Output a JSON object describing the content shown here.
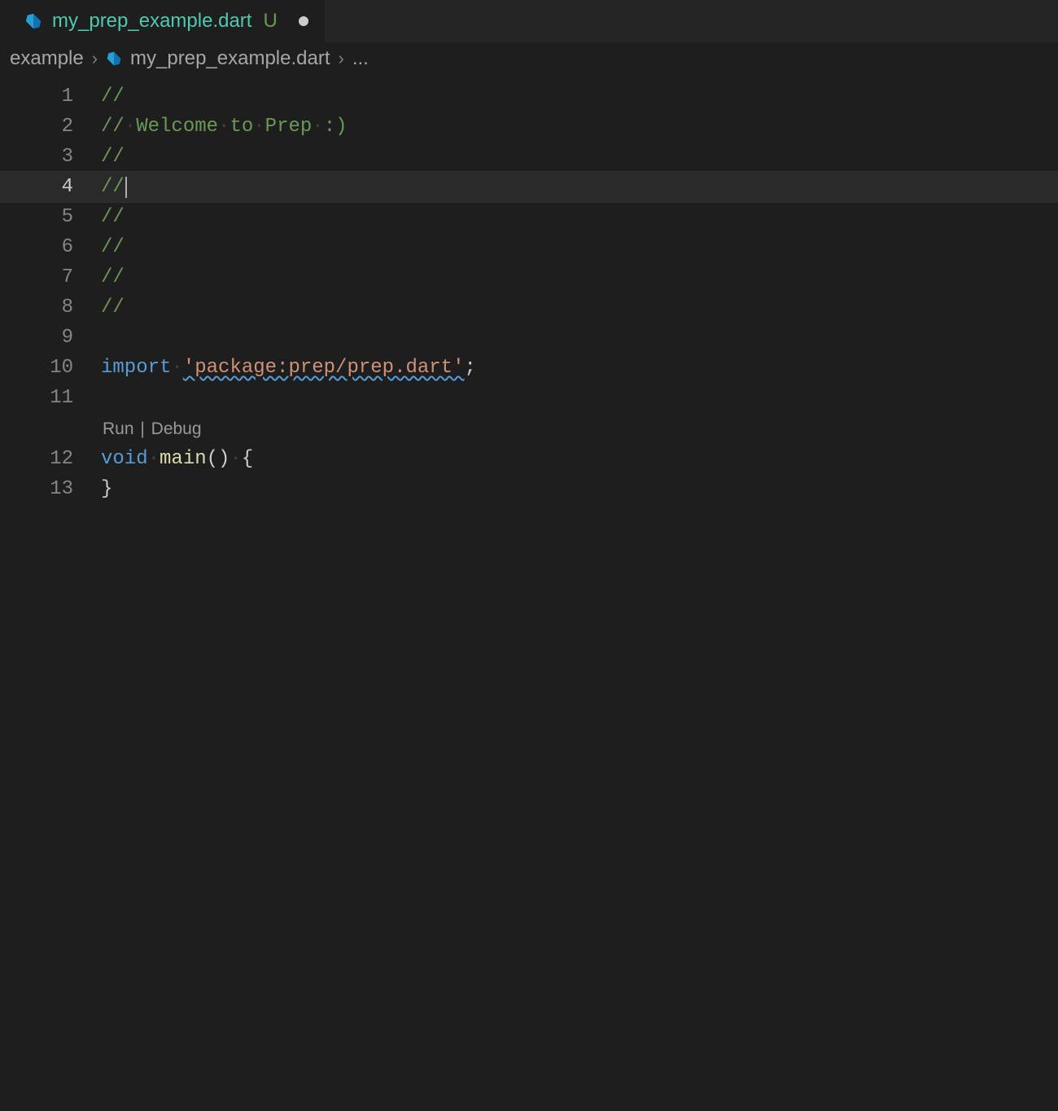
{
  "tab": {
    "filename": "my_prep_example.dart",
    "status": "U",
    "dirty": true
  },
  "breadcrumbs": {
    "folder": "example",
    "file": "my_prep_example.dart",
    "symbol": "..."
  },
  "codelens": {
    "run": "Run",
    "debug": "Debug"
  },
  "lines": {
    "l1_num": "1",
    "l2_num": "2",
    "l3_num": "3",
    "l4_num": "4",
    "l5_num": "5",
    "l6_num": "6",
    "l7_num": "7",
    "l8_num": "8",
    "l9_num": "9",
    "l10_num": "10",
    "l11_num": "11",
    "l12_num": "12",
    "l13_num": "13",
    "comment_slash": "//",
    "welcome": "Welcome",
    "to": "to",
    "prep": "Prep",
    "smiley": ":)",
    "import_kw": "import",
    "import_str": "'package:prep/prep.dart'",
    "semicolon": ";",
    "void_kw": "void",
    "main_fn": "main",
    "parens": "()",
    "open_brace": "{",
    "close_brace": "}"
  }
}
